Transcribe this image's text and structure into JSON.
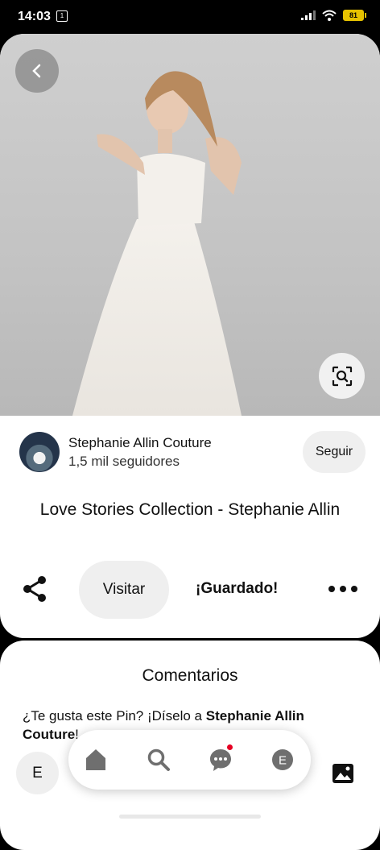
{
  "status_bar": {
    "time": "14:03",
    "notification_badge": "1",
    "battery": "81"
  },
  "pin": {
    "image_description_icon": "wedding-dress-photo",
    "creator_name": "Stephanie Allin Couture",
    "creator_followers": "1,5 mil seguidores",
    "follow_label": "Seguir",
    "title": "Love Stories Collection - Stephanie Allin",
    "visit_label": "Visitar",
    "saved_label": "¡Guardado!"
  },
  "comments": {
    "title": "Comentarios",
    "prompt_prefix": "¿Te gusta este Pin? ¡Díselo a ",
    "prompt_name": "Stephanie Allin Couture",
    "prompt_suffix": "!",
    "user_initial": "E"
  },
  "nav": {
    "profile_initial": "E",
    "notification_color": "#e60023"
  },
  "colors": {
    "accent_red": "#e60023",
    "button_gray": "#efefef"
  }
}
